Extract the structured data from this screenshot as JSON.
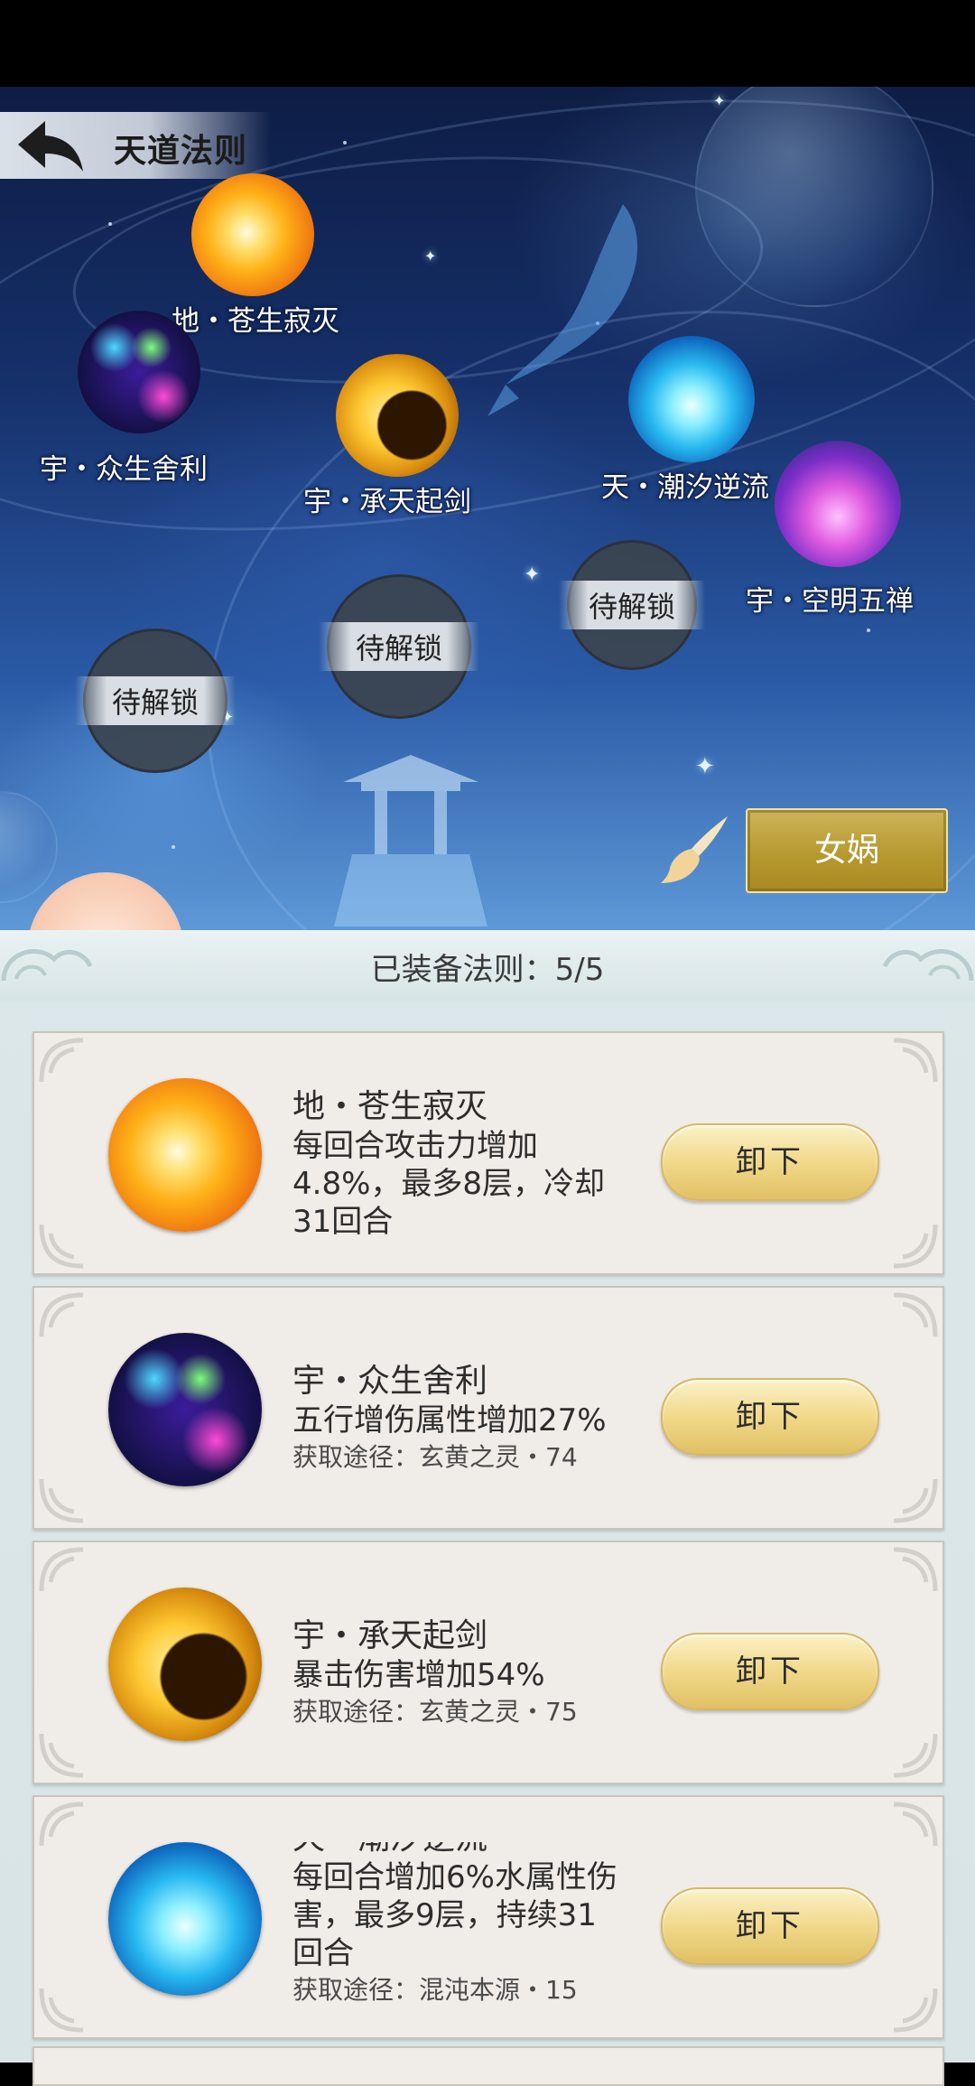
{
  "header": {
    "title": "天道法则"
  },
  "map": {
    "nodes": [
      {
        "name": "地・苍生寂灭",
        "icon": "fire-burst-icon"
      },
      {
        "name": "宇・众生舍利",
        "icon": "cosmic-orbs-icon"
      },
      {
        "name": "宇・承天起剑",
        "icon": "golden-crescent-icon"
      },
      {
        "name": "天・潮汐逆流",
        "icon": "water-swirl-icon"
      },
      {
        "name": "宇・空明五禅",
        "icon": "crystal-pillars-icon"
      }
    ],
    "locked_label": "待解锁"
  },
  "character_button": {
    "label": "女娲"
  },
  "panel": {
    "equipped_label": "已装备法则：5/5",
    "items": [
      {
        "name": "地・苍生寂灭",
        "desc": "每回合攻击力增加4.8%，最多8层，冷却31回合",
        "source": "",
        "button": "卸下",
        "icon": "fire-burst-icon"
      },
      {
        "name": "宇・众生舍利",
        "desc": "五行增伤属性增加27%",
        "source": "获取途径：玄黄之灵・74",
        "button": "卸下",
        "icon": "cosmic-orbs-icon"
      },
      {
        "name": "宇・承天起剑",
        "desc": "暴击伤害增加54%",
        "source": "获取途径：玄黄之灵・75",
        "button": "卸下",
        "icon": "golden-crescent-icon"
      },
      {
        "name": "天・潮汐逆流",
        "desc": "每回合增加6%水属性伤害，最多9层，持续31回合",
        "source": "获取途径：混沌本源・15",
        "button": "卸下",
        "icon": "water-swirl-icon"
      }
    ]
  }
}
